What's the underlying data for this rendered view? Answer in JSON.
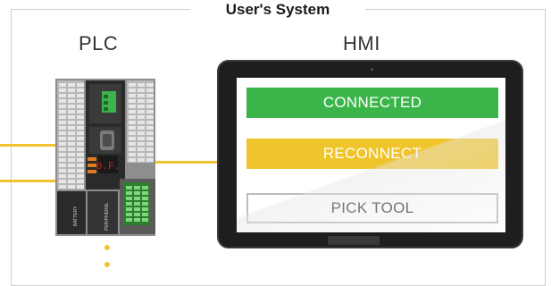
{
  "title": "User's System",
  "plc": {
    "label": "PLC",
    "display_text": "0.F.",
    "slot_labels": [
      "BATTERY",
      "PERIPHERAL"
    ]
  },
  "hmi": {
    "label": "HMI",
    "buttons": [
      {
        "label": "CONNECTED",
        "color": "#3bb54a"
      },
      {
        "label": "RECONNECT",
        "color": "#f0c42b"
      },
      {
        "label": "PICK TOOL",
        "color": "#ffffff"
      }
    ]
  },
  "colors": {
    "wire": "#f2c230",
    "frame": "#cfcfcf"
  }
}
